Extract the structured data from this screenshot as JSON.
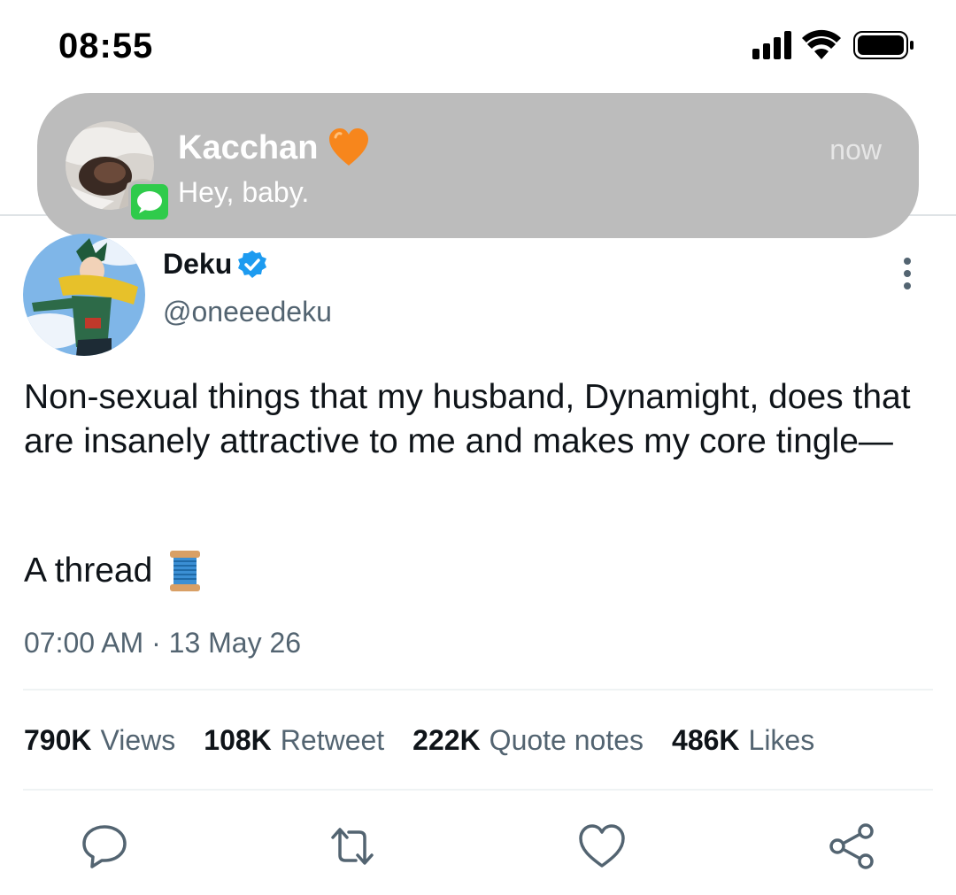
{
  "status_bar": {
    "time": "08:55"
  },
  "notification": {
    "sender": "Kacchan",
    "message": "Hey, baby.",
    "time": "now",
    "app_icon": "messages-icon",
    "emoji": "orange-heart"
  },
  "tweet": {
    "display_name": "Deku",
    "handle": "@oneeedeku",
    "verified": true,
    "text": "Non-sexual things that my husband, Dynamight, does that are insanely attractive to me and makes my core tingle—",
    "thread_text": "A thread",
    "thread_emoji": "spool-of-thread",
    "timestamp": "07:00 AM · 13 May 26"
  },
  "stats": [
    {
      "count": "790K",
      "label": "Views"
    },
    {
      "count": "108K",
      "label": "Retweet"
    },
    {
      "count": "222K",
      "label": "Quote notes"
    },
    {
      "count": "486K",
      "label": "Likes"
    }
  ],
  "actions": [
    "reply-icon",
    "retweet-icon",
    "like-icon",
    "share-icon"
  ],
  "colors": {
    "text": "#0f1419",
    "secondary": "#536471",
    "verified": "#1d9bf0",
    "notification_bg": "#bcbcbc"
  }
}
